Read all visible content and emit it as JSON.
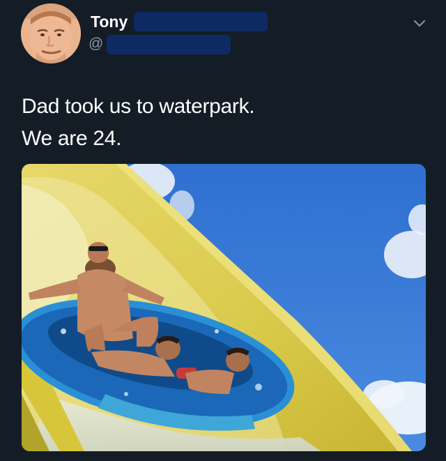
{
  "user": {
    "display_name": "Tony",
    "handle_prefix": "@",
    "avatar_icon": "avatar-photo"
  },
  "tweet": {
    "lines": [
      "Dad took us to waterpark.",
      "We are 24."
    ]
  },
  "icons": {
    "menu": "chevron-down-icon"
  },
  "colors": {
    "background": "#141d26",
    "redaction": "#0e2a63",
    "secondary_text": "#8899a6"
  }
}
